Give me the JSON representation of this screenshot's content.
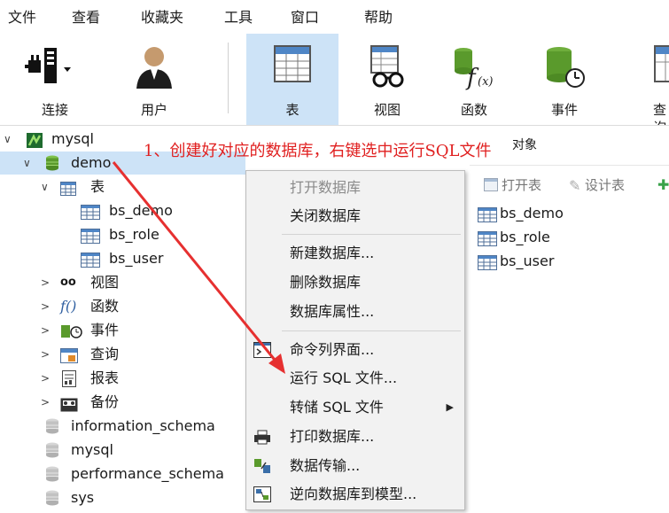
{
  "menubar": {
    "items": [
      "文件",
      "查看",
      "收藏夹",
      "工具",
      "窗口",
      "帮助"
    ]
  },
  "toolbar": {
    "buttons": [
      {
        "label": "连接",
        "icon": "connection-plug-icon"
      },
      {
        "label": "用户",
        "icon": "user-icon"
      },
      {
        "label": "表",
        "icon": "table-icon",
        "active": true
      },
      {
        "label": "视图",
        "icon": "view-glasses-icon"
      },
      {
        "label": "函数",
        "icon": "function-icon"
      },
      {
        "label": "事件",
        "icon": "event-clock-icon"
      },
      {
        "label": "查询",
        "icon": "query-icon"
      }
    ]
  },
  "tree": {
    "connection": "mysql",
    "database": "demo",
    "tables_label": "表",
    "tables": [
      "bs_demo",
      "bs_role",
      "bs_user"
    ],
    "groups": [
      "视图",
      "函数",
      "事件",
      "查询",
      "报表",
      "备份"
    ],
    "other_databases": [
      "information_schema",
      "mysql",
      "performance_schema",
      "sys"
    ]
  },
  "right_pane": {
    "tab": "对象",
    "tools": [
      "打开表",
      "设计表"
    ],
    "objects": [
      "bs_demo",
      "bs_role",
      "bs_user"
    ]
  },
  "context_menu": {
    "items": [
      {
        "label": "打开数据库",
        "disabled": true
      },
      {
        "label": "关闭数据库"
      },
      {
        "label": "新建数据库..."
      },
      {
        "label": "删除数据库"
      },
      {
        "label": "数据库属性..."
      },
      {
        "label": "命令列界面..."
      },
      {
        "label": "运行 SQL 文件..."
      },
      {
        "label": "转储 SQL 文件"
      },
      {
        "label": "打印数据库..."
      },
      {
        "label": "数据传输..."
      },
      {
        "label": "逆向数据库到模型..."
      }
    ]
  },
  "annotation": {
    "text": "1、创建好对应的数据库，右键选中运行SQL文件",
    "color": "#e02020"
  }
}
